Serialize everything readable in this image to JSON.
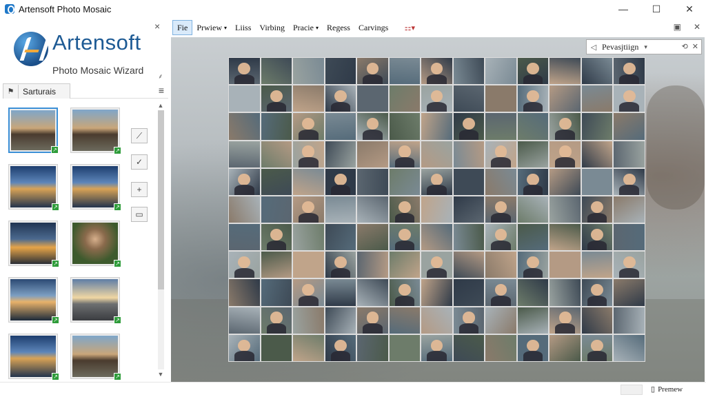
{
  "window": {
    "title": "Artensoft Photo Mosaic",
    "minimize": "—",
    "maximize": "☐",
    "close": "✕"
  },
  "logo": {
    "name": "Artensoft",
    "subtitle": "Photo Mosaic Wizard"
  },
  "left_panel": {
    "close": "×",
    "tab_label": "Sarturais",
    "flag_icon": "⚑",
    "menu_icon": "≡"
  },
  "menu": {
    "items": [
      "Fie",
      "Prwiew",
      "Liiss",
      "Virbing",
      "Pracie",
      "Regess",
      "Carvings"
    ],
    "carets": [
      "",
      "▾",
      "",
      "",
      "▾",
      "",
      ""
    ]
  },
  "toolbar_right": {
    "icon_a": "▣",
    "icon_b": "✕"
  },
  "preview_dropdown": {
    "icon": "◁",
    "label": "Pevasjtiign",
    "caret": "▾",
    "right_icon": "⟲",
    "close_icon": "✕"
  },
  "status": {
    "preview_icon": "▯",
    "preview_label": "Premew"
  },
  "thumbnails": [
    {
      "tone": "dusk-house",
      "selected": true
    },
    {
      "tone": "dusk-house",
      "selected": false
    },
    {
      "tone": "blue-lake",
      "selected": false
    },
    {
      "tone": "blue-lake",
      "selected": false
    },
    {
      "tone": "chapel-night",
      "selected": false
    },
    {
      "tone": "child-portrait",
      "selected": false
    },
    {
      "tone": "bridge-lights",
      "selected": false
    },
    {
      "tone": "sunset-pier",
      "selected": false
    },
    {
      "tone": "blue-lake",
      "selected": false
    },
    {
      "tone": "dusk-house",
      "selected": false
    }
  ],
  "tool_buttons": [
    "⟋",
    "✓",
    "+",
    "▭"
  ],
  "mosaic": {
    "columns": 13,
    "rows": 11,
    "palette": [
      "#5b6670",
      "#7a8a94",
      "#9aa3a0",
      "#4b5a4a",
      "#8a7a6a",
      "#2f3a48",
      "#b49a84",
      "#6d7c6a",
      "#a8b2b8",
      "#3e4a56",
      "#c0a48a",
      "#556b7a"
    ],
    "face_cells": [
      0,
      4,
      6,
      9,
      12,
      14,
      16,
      19,
      22,
      25,
      28,
      30,
      33,
      36,
      41,
      44,
      47,
      49,
      52,
      55,
      58,
      61,
      64,
      67,
      70,
      73,
      76,
      79,
      83,
      86,
      89,
      91,
      94,
      97,
      100,
      103,
      106,
      109,
      112,
      115,
      118,
      121,
      124,
      127,
      130,
      133,
      136,
      139,
      141
    ]
  }
}
